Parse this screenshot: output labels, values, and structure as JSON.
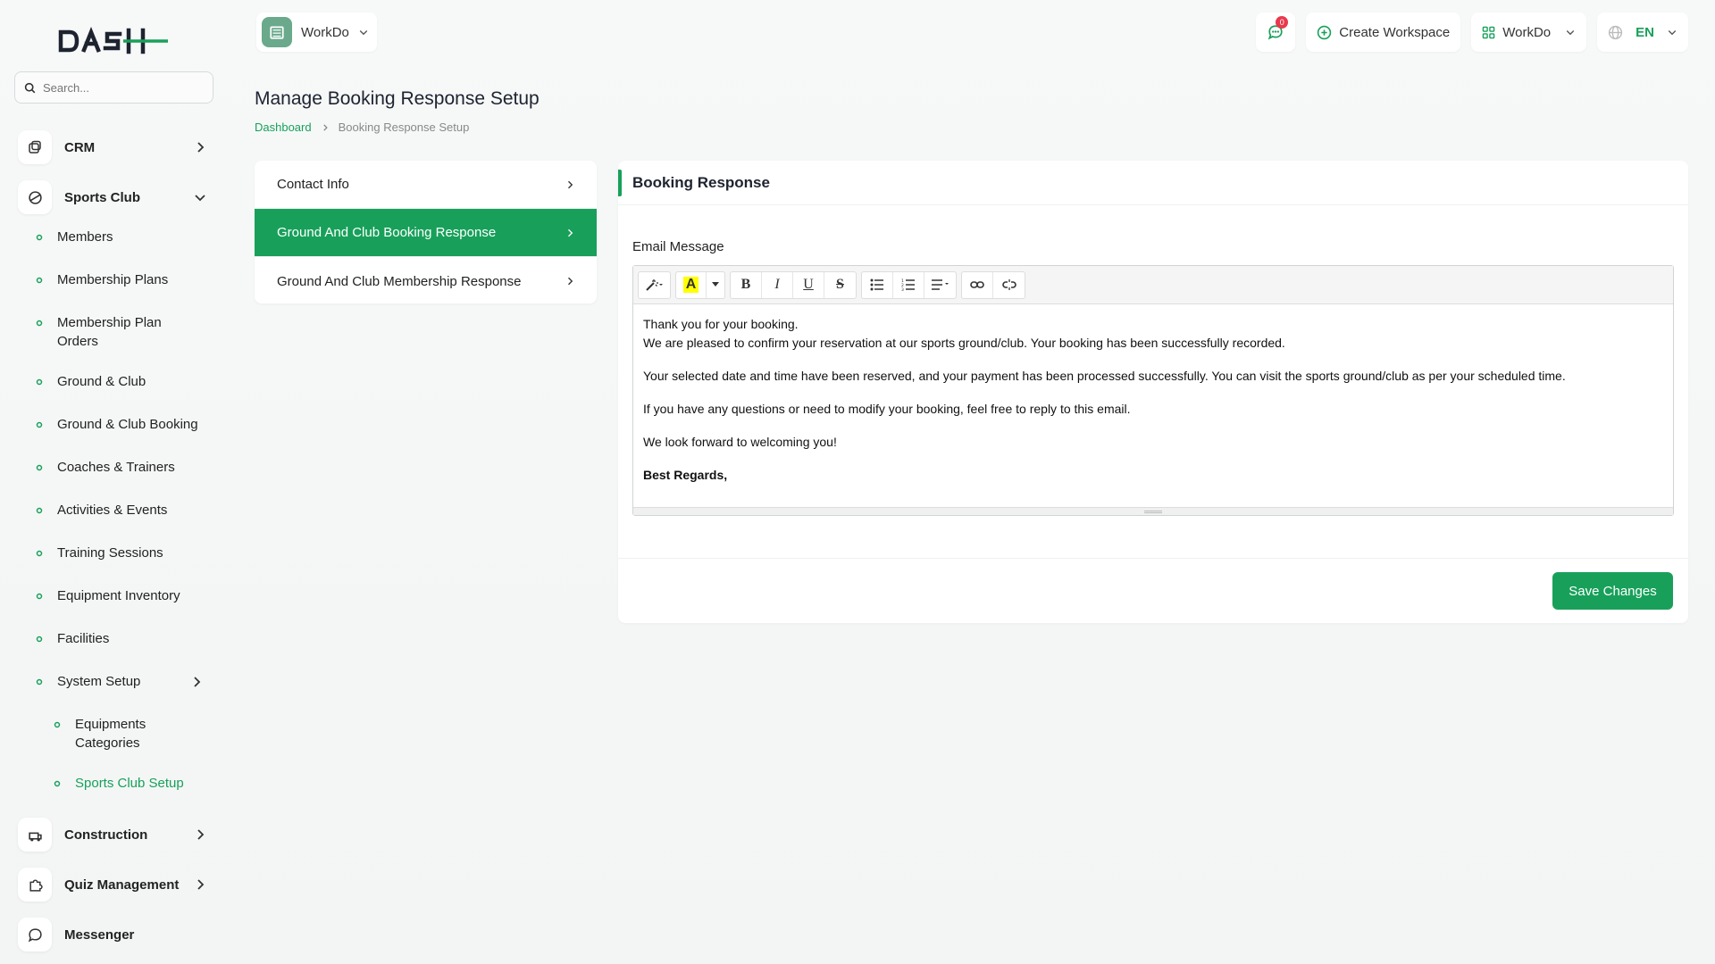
{
  "brand": {
    "logo_text": "DASH",
    "accent": "#18a05a"
  },
  "search": {
    "placeholder": "Search..."
  },
  "sidebar": {
    "crm": "CRM",
    "sports_club": "Sports Club",
    "sports_items": [
      "Members",
      "Membership Plans",
      "Membership Plan Orders",
      "Ground & Club",
      "Ground & Club Booking",
      "Coaches & Trainers",
      "Activities & Events",
      "Training Sessions",
      "Equipment Inventory",
      "Facilities",
      "System Setup"
    ],
    "system_setup_items": [
      "Equipments Categories",
      "Sports Club Setup"
    ],
    "construction": "Construction",
    "quiz_management": "Quiz Management",
    "messenger": "Messenger"
  },
  "topbar": {
    "workspace": "WorkDo",
    "notification_count": "0",
    "create_workspace": "Create Workspace",
    "user_workspace": "WorkDo",
    "language": "EN"
  },
  "page": {
    "title": "Manage Booking Response Setup",
    "breadcrumb_home": "Dashboard",
    "breadcrumb_current": "Booking Response Setup"
  },
  "tabs": [
    "Contact Info",
    "Ground And Club Booking Response",
    "Ground And Club Membership Response"
  ],
  "card": {
    "title": "Booking Response",
    "field_label": "Email Message",
    "message": {
      "line1": "Thank you for your booking.",
      "line2": "We are pleased to confirm your reservation at our sports ground/club. Your booking has been successfully recorded.",
      "para2": "Your selected date and time have been reserved, and your payment has been processed successfully. You can visit the sports ground/club as per your scheduled time.",
      "para3": "If you have any questions or need to modify your booking, feel free to reply to this email.",
      "para4": "We look forward to welcoming you!",
      "closing": "Best Regards,"
    },
    "save_label": "Save Changes"
  }
}
